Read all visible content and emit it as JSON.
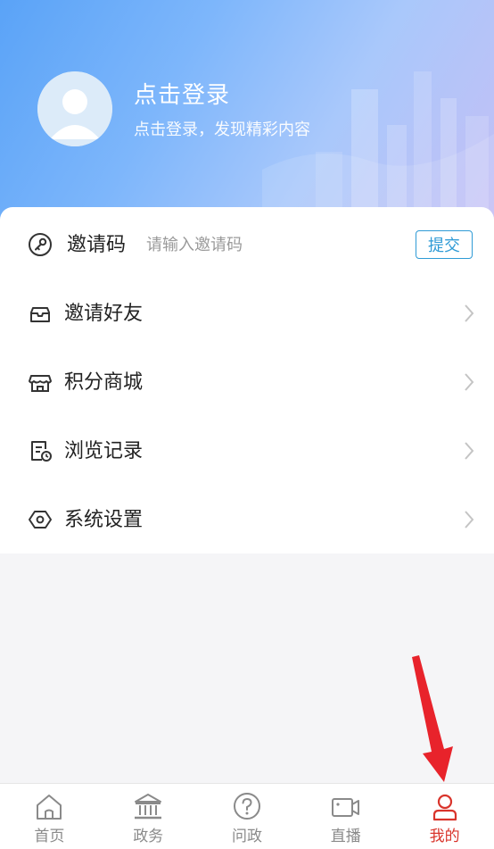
{
  "profile": {
    "title": "点击登录",
    "subtitle": "点击登录，发现精彩内容"
  },
  "invite": {
    "label": "邀请码",
    "placeholder": "请输入邀请码",
    "submit_label": "提交"
  },
  "menu": [
    {
      "label": "邀请好友",
      "icon": "envelope-icon"
    },
    {
      "label": "积分商城",
      "icon": "store-icon"
    },
    {
      "label": "浏览记录",
      "icon": "history-icon"
    },
    {
      "label": "系统设置",
      "icon": "settings-hexagon-icon"
    }
  ],
  "tabs": [
    {
      "label": "首页",
      "icon": "home-icon",
      "active": false
    },
    {
      "label": "政务",
      "icon": "government-building-icon",
      "active": false
    },
    {
      "label": "问政",
      "icon": "question-circle-icon",
      "active": false
    },
    {
      "label": "直播",
      "icon": "video-camera-icon",
      "active": false
    },
    {
      "label": "我的",
      "icon": "user-icon",
      "active": true
    }
  ],
  "colors": {
    "accent_red": "#d9342b",
    "link_blue": "#2f9bd6",
    "header_gradient_start": "#5aa3f7",
    "header_gradient_end": "#c4bff5"
  }
}
